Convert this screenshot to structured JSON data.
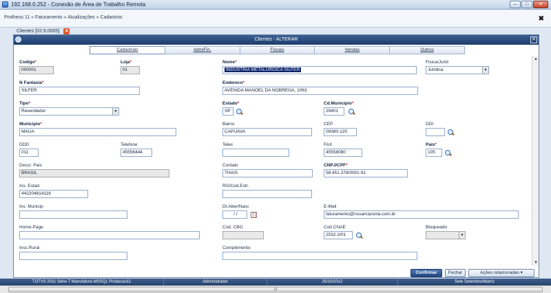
{
  "window": {
    "title": "192.168.0.252 - Conexão de Área de Trabalho Remota"
  },
  "breadcrumb": "Protheus 11 » Faturamento » Atualizações » Cadastros",
  "doc_tab": {
    "label": "Clientes [02.9.0005]"
  },
  "dialog": {
    "title": "Clientes - ALTERAR"
  },
  "tabs": [
    "Cadastrais",
    "Adm/Fin.",
    "Fiscais",
    "Vendas",
    "Outros"
  ],
  "fields": {
    "codigo": {
      "label": "Codigo",
      "value": "000001"
    },
    "loja": {
      "label": "Loja",
      "value": "01"
    },
    "nome": {
      "label": "Nome",
      "value": "INDUSTRIA METALURGICA SILFER"
    },
    "fisica_jurid": {
      "label": "Fisica/Jurid",
      "value": "Juridica"
    },
    "nfantasia": {
      "label": "N Fantasia",
      "value": "SILFER"
    },
    "endereco": {
      "label": "Endereco",
      "value": "AVENIDA MANOEL DA NOBREGA, 1063"
    },
    "tipo": {
      "label": "Tipo",
      "value": "Revendedor"
    },
    "estado": {
      "label": "Estado",
      "value": "SP"
    },
    "cd_municipio": {
      "label": "Cd.Municipio",
      "value": "29401"
    },
    "municipio": {
      "label": "Municipio",
      "value": "MAUA"
    },
    "bairro": {
      "label": "Bairro",
      "value": "CAPUAVA"
    },
    "cep": {
      "label": "CEP",
      "value": "09380-120"
    },
    "ddi": {
      "label": "DDI",
      "value": ""
    },
    "ddd": {
      "label": "DDD",
      "value": "011"
    },
    "telefone": {
      "label": "Telefone",
      "value": "45556444"
    },
    "telex": {
      "label": "Telex",
      "value": ""
    },
    "fax": {
      "label": "FAX",
      "value": "45558080"
    },
    "pais": {
      "label": "Pais",
      "value": "105"
    },
    "descr_pais": {
      "label": "Descr. Pais",
      "value": "BRASIL"
    },
    "contato": {
      "label": "Contato",
      "value": "THAIS"
    },
    "cnpj": {
      "label": "CNPJ/CPF",
      "value": "58.451.378/0001-91"
    },
    "ins_estad": {
      "label": "Ins. Estad.",
      "value": "442204814116"
    },
    "rg": {
      "label": "RG/Ced.Estr.",
      "value": ""
    },
    "ins_municip": {
      "label": "Ins. Municip",
      "value": ""
    },
    "dt_aber": {
      "label": "Dt.Aber/Nasc",
      "value": "/ /"
    },
    "email": {
      "label": "E-Mail",
      "value": "faturamento@nssamazonia.com.br"
    },
    "homepage": {
      "label": "Home-Page",
      "value": ""
    },
    "cod_cbo": {
      "label": "Cod. CBO",
      "value": ""
    },
    "cod_cnae": {
      "label": "Cod CNAE",
      "value": "2532-2/01"
    },
    "bloqueado": {
      "label": "Bloqueado",
      "value": ""
    },
    "insc_rural": {
      "label": "Insc.Rural",
      "value": ""
    },
    "complemento": {
      "label": "Complemento",
      "value": ""
    }
  },
  "buttons": {
    "confirm": "Confirmar",
    "close": "Fechar",
    "actions": "Ações relacionadas"
  },
  "status_bar": [
    "TOTVS 2011 Série T Manufatura MSSQL Producao11",
    "Administrador",
    "25/10/2012",
    "Sete Setembro/Matriz"
  ]
}
